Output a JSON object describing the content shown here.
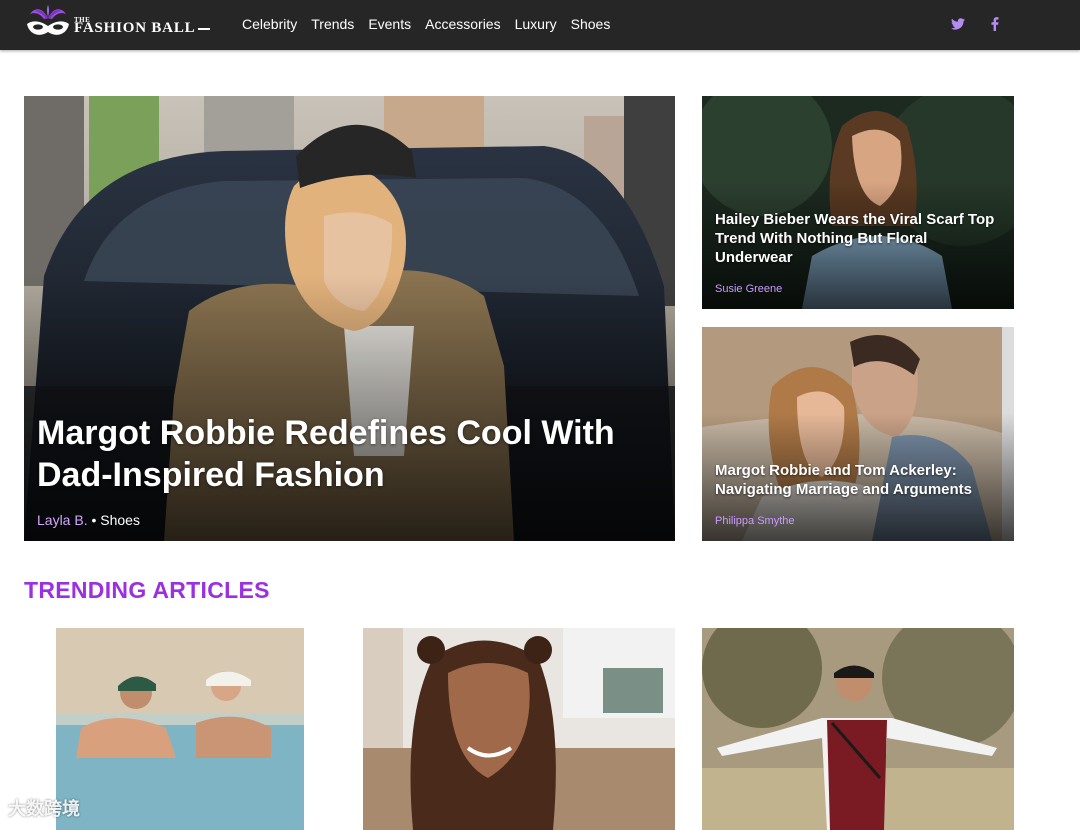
{
  "brand": {
    "small": "THE",
    "name": "FASHION BALL"
  },
  "nav": {
    "items": [
      "Celebrity",
      "Trends",
      "Events",
      "Accessories",
      "Luxury",
      "Shoes"
    ],
    "social": {
      "twitter": "twitter-icon",
      "facebook": "facebook-icon"
    }
  },
  "hero": {
    "title": "Margot Robbie Redefines Cool With Dad-Inspired Fashion",
    "author": "Layla B.",
    "category": "• Shoes"
  },
  "side_articles": [
    {
      "title": "Hailey Bieber Wears the Viral Scarf Top Trend With Nothing But Floral Underwear",
      "author": "Susie Greene"
    },
    {
      "title": "Margot Robbie and Tom Ackerley: Navigating Marriage and Arguments",
      "author": "Philippa Smythe"
    }
  ],
  "trending": {
    "heading": "TRENDING ARTICLES"
  },
  "watermark": "大数跨境",
  "colors": {
    "accent": "#9b30e0",
    "nav_bg": "#262626",
    "author": "#c99cff",
    "social": "#b48cf0"
  }
}
